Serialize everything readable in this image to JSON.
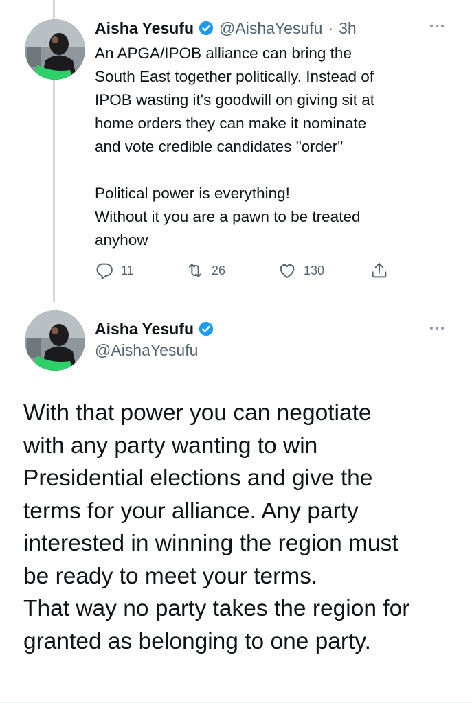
{
  "tweet1": {
    "display_name": "Aisha Yesufu",
    "handle": "@AishaYesufu",
    "separator": "·",
    "time": "3h",
    "text_lines": [
      "An APGA/IPOB alliance can bring the",
      "South East together politically. Instead of",
      "IPOB wasting it's goodwill on giving sit at",
      "home orders they can make it nominate",
      "and  vote credible candidates \"order\""
    ],
    "text_lines_2": [
      "Political power is everything!",
      "Without it you are a pawn to be treated",
      "anyhow"
    ],
    "replies": "11",
    "retweets": "26",
    "likes": "130",
    "icons": [
      "reply-icon",
      "retweet-icon",
      "like-icon",
      "share-icon",
      "more-icon",
      "verified-icon"
    ]
  },
  "tweet2": {
    "display_name": "Aisha Yesufu",
    "handle": "@AishaYesufu",
    "text_lines": [
      "With that power you can negotiate",
      "with any party wanting to win",
      "Presidential elections and give the",
      "terms for your alliance. Any party",
      "interested in winning  the region must",
      "be ready to meet your terms.",
      "That way no party takes the region for",
      "granted as belonging to one party."
    ]
  },
  "colors": {
    "text": "#0f1419",
    "secondary": "#536471",
    "verified": "#1d9bf0",
    "thread_line": "#cfd9de"
  }
}
